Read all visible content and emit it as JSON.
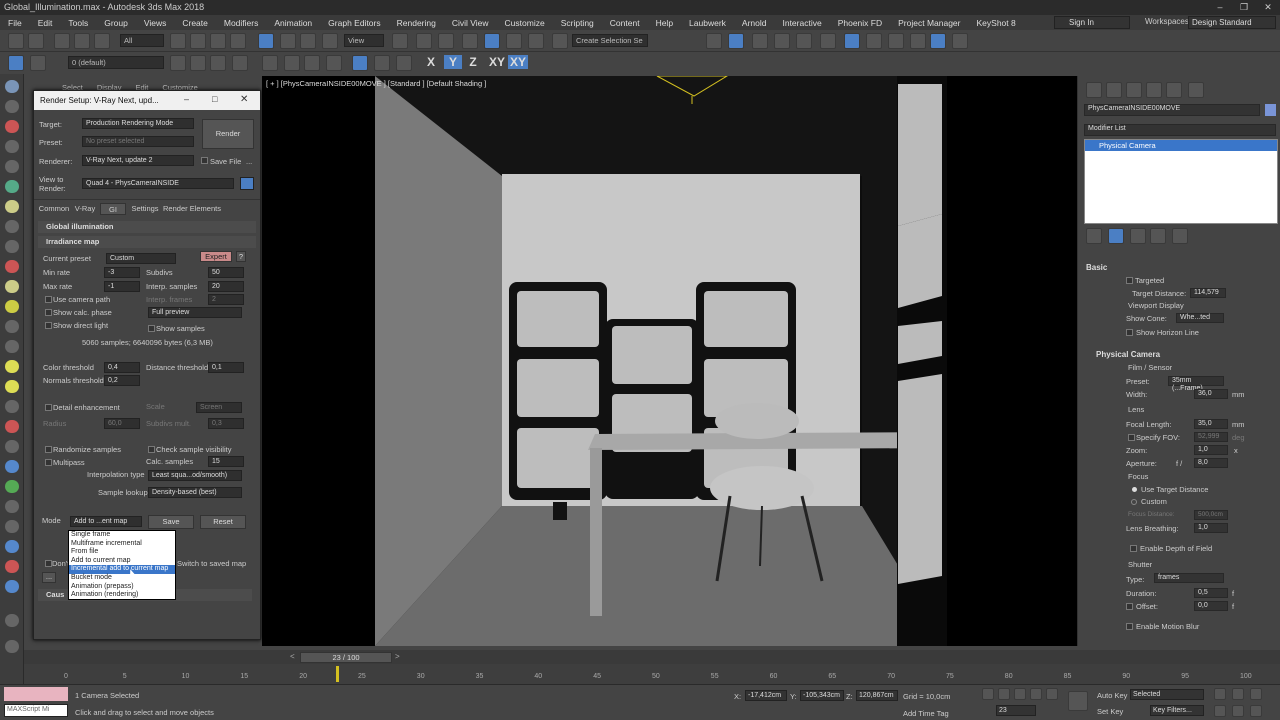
{
  "window": {
    "title": "Global_Illumination.max - Autodesk 3ds Max 2018"
  },
  "menu": [
    "File",
    "Edit",
    "Tools",
    "Group",
    "Views",
    "Create",
    "Modifiers",
    "Animation",
    "Graph Editors",
    "Rendering",
    "Civil View",
    "Customize",
    "Scripting",
    "Content",
    "Help",
    "Laubwerk",
    "Arnold",
    "Interactive",
    "Phoenix FD",
    "Project Manager",
    "KeyShot 8"
  ],
  "signin": "Sign In",
  "workspaces_label": "Workspaces:",
  "workspaces_value": "Design Standard",
  "toolbar": {
    "filter": "All",
    "view": "View",
    "selection_set": "Create Selection Se",
    "layer": "0 (default)",
    "axes": [
      "X",
      "Y",
      "Z",
      "XY",
      "XY"
    ]
  },
  "scene_explorer_menu": [
    "Select",
    "Display",
    "Edit",
    "Customize"
  ],
  "viewport": {
    "label": "[ + ] [PhysCameraINSIDE00MOVE ] [Standard ] [Default Shading ]"
  },
  "dialog": {
    "title": "Render Setup: V-Ray Next, upd...",
    "target_label": "Target:",
    "target_value": "Production Rendering Mode",
    "preset_label": "Preset:",
    "preset_value": "No preset selected",
    "renderer_label": "Renderer:",
    "renderer_value": "V-Ray Next, update 2",
    "save_file": "Save File",
    "view_label": "View to Render:",
    "view_value": "Quad 4 - PhysCameraINSIDE",
    "render_btn": "Render",
    "tabs": [
      "Common",
      "V-Ray",
      "GI",
      "Settings",
      "Render Elements"
    ],
    "rollout_gi": "Global illumination",
    "rollout_irr": "Irradiance map",
    "current_preset_label": "Current preset",
    "current_preset_value": "Custom",
    "expert_btn": "Expert",
    "help_btn": "?",
    "min_rate_label": "Min rate",
    "min_rate": "-3",
    "max_rate_label": "Max rate",
    "max_rate": "-1",
    "subdivs_label": "Subdivs",
    "subdivs": "50",
    "interp_samples_label": "Interp. samples",
    "interp_samples": "20",
    "interp_frames_label": "Interp. frames",
    "interp_frames": "2",
    "use_camera_path": "Use camera path",
    "show_calc_phase": "Show calc. phase",
    "show_direct_light": "Show direct light",
    "full_preview": "Full preview",
    "show_samples": "Show samples",
    "samples_info": "5060 samples; 6640096 bytes (6,3 MB)",
    "color_threshold_label": "Color threshold",
    "color_threshold": "0,4",
    "normals_threshold_label": "Normals threshold",
    "normals_threshold": "0,2",
    "distance_threshold_label": "Distance threshold",
    "distance_threshold": "0,1",
    "detail_enhancement": "Detail enhancement",
    "scale_label": "Scale",
    "scale_value": "Screen",
    "radius_label": "Radius",
    "radius_value": "60,0",
    "subdivs_mult_label": "Subdivs mult.",
    "subdivs_mult": "0,3",
    "randomize_samples": "Randomize samples",
    "check_sample_visibility": "Check sample visibility",
    "multipass": "Multipass",
    "calc_samples_label": "Calc. samples",
    "calc_samples": "15",
    "interpolation_type_label": "Interpolation type",
    "interpolation_type": "Least squa...od/smooth)",
    "sample_lookup_label": "Sample lookup",
    "sample_lookup": "Density-based (best)",
    "mode_label": "Mode",
    "mode_value": "Add to ...ent map",
    "save_btn": "Save",
    "reset_btn": "Reset",
    "dont_delete": "Don't",
    "switch_saved": "Switch to saved map",
    "caustics": "Caus",
    "mode_options": [
      "Single frame",
      "Multiframe incremental",
      "From file",
      "Add to current map",
      "Incremental add to current map",
      "Bucket mode",
      "Animation (prepass)",
      "Animation (rendering)"
    ],
    "mode_selected_index": 4
  },
  "command_panel": {
    "object_name": "PhysCameraINSIDE00MOVE",
    "modifier_list": "Modifier List",
    "stack_item": "Physical Camera",
    "basic": "Basic",
    "targeted": "Targeted",
    "target_distance_label": "Target Distance:",
    "target_distance": "114,579",
    "viewport_display": "Viewport Display",
    "show_cone_label": "Show Cone:",
    "show_cone": "Whe...ted",
    "show_horizon_line": "Show Horizon Line",
    "physical_camera": "Physical Camera",
    "film_sensor": "Film / Sensor",
    "preset_label": "Preset:",
    "preset": "35mm (...Frame)",
    "width_label": "Width:",
    "width": "36,0",
    "mm": "mm",
    "lens": "Lens",
    "focal_length_label": "Focal Length:",
    "focal_length": "35,0",
    "specify_fov": "Specify FOV:",
    "fov": "52,999",
    "deg": "deg",
    "zoom_label": "Zoom:",
    "zoom": "1,0",
    "x": "x",
    "aperture_label": "Aperture:",
    "aperture_f": "f /",
    "aperture": "8,0",
    "focus": "Focus",
    "use_target_distance": "Use Target Distance",
    "custom": "Custom",
    "focus_distance_label": "Focus Distance:",
    "focus_distance": "500,0cm",
    "lens_breathing_label": "Lens Breathing:",
    "lens_breathing": "1,0",
    "enable_dof": "Enable Depth of Field",
    "shutter": "Shutter",
    "type_label": "Type:",
    "type": "frames",
    "duration_label": "Duration:",
    "duration": "0,5",
    "f": "f",
    "offset_label": "Offset:",
    "offset": "0,0",
    "enable_motion_blur": "Enable Motion Blur"
  },
  "timeline": {
    "slider": "23 / 100",
    "ticks": [
      "0",
      "5",
      "10",
      "15",
      "20",
      "25",
      "30",
      "35",
      "40",
      "45",
      "50",
      "55",
      "60",
      "65",
      "70",
      "75",
      "80",
      "85",
      "90",
      "95",
      "100"
    ]
  },
  "status": {
    "maxscript": "MAXScript Mi",
    "selected": "1 Camera Selected",
    "prompt": "Click and drag to select and move objects",
    "x_label": "X:",
    "x": "-17,412cm",
    "y_label": "Y:",
    "y": "-105,343cm",
    "z_label": "Z:",
    "z": "120,867cm",
    "grid": "Grid = 10,0cm",
    "add_time_tag": "Add Time Tag",
    "auto_key": "Auto Key",
    "selected_dd": "Selected",
    "set_key": "Set Key",
    "key_filters": "Key Filters...",
    "frame": "23"
  }
}
